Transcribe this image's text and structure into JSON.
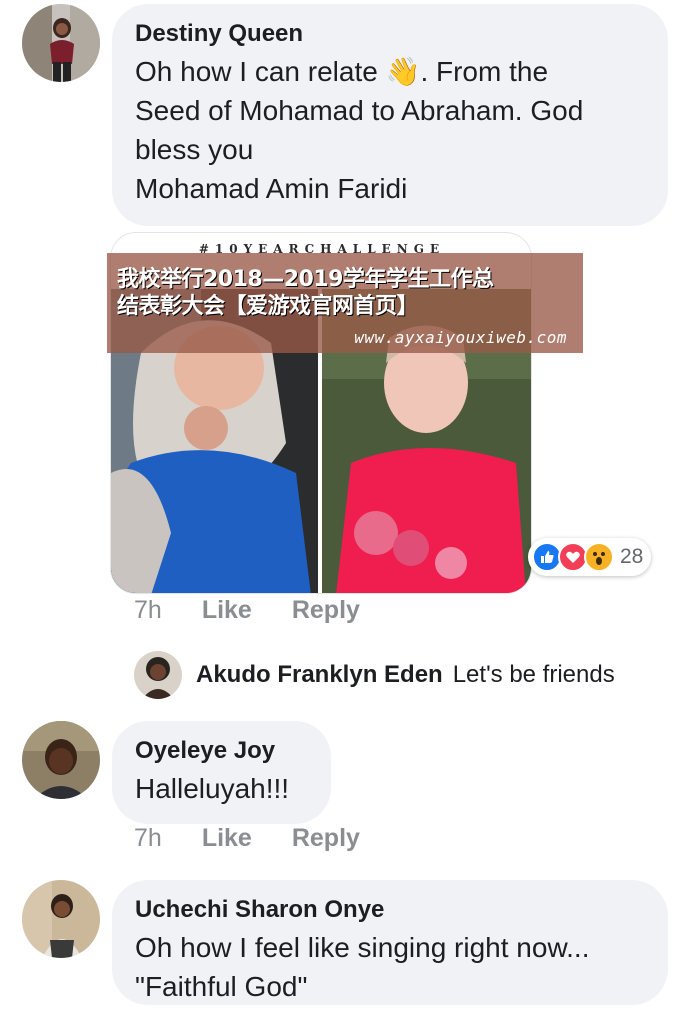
{
  "comments": [
    {
      "author": "Destiny Queen",
      "lines": [
        "Oh how I can relate 👋. From the",
        "Seed of Mohamad to Abraham. God",
        "bless you",
        "Mohamad Amin Faridi"
      ],
      "photo_caption": "#10YEARCHALLENGE",
      "reactions": {
        "icons": [
          "like-icon",
          "love-icon",
          "wow-icon"
        ],
        "count": "28"
      },
      "time": "7h",
      "like_label": "Like",
      "reply_label": "Reply",
      "reply": {
        "author": "Akudo Franklyn Eden",
        "text": "Let's be friends"
      }
    },
    {
      "author": "Oyeleye Joy",
      "lines": [
        "Halleluyah!!!"
      ],
      "time": "7h",
      "like_label": "Like",
      "reply_label": "Reply"
    },
    {
      "author": "Uchechi Sharon Onye",
      "lines": [
        "Oh how I feel like singing right now...",
        "\"Faithful God\""
      ]
    }
  ],
  "watermark": {
    "line1": "我校举行2018—2019学年学生工作总",
    "line2": "结表彰大会【爱游戏官网首页】",
    "url": "www.ayxaiyouxiweb.com"
  },
  "colors": {
    "bubble": "#f0f2f5",
    "meta": "#8a8d91",
    "like": "#1877f2",
    "love": "#f33e58",
    "wow": "#f7b125"
  }
}
